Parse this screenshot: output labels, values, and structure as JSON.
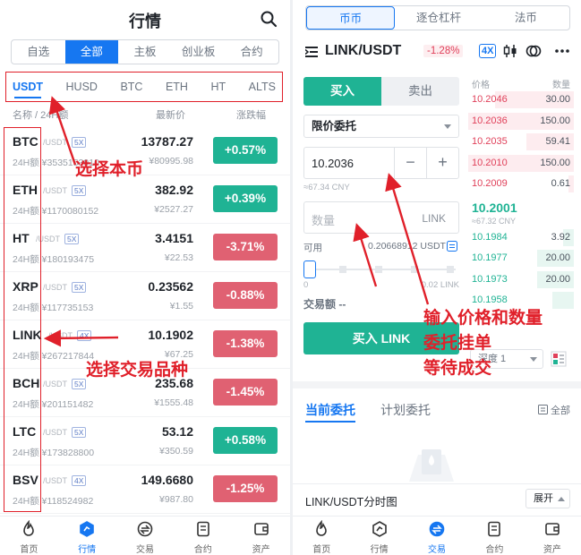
{
  "left": {
    "title": "行情",
    "segments": [
      "自选",
      "全部",
      "主板",
      "创业板",
      "合约"
    ],
    "active_segment": 1,
    "quote_tabs": [
      "USDT",
      "HUSD",
      "BTC",
      "ETH",
      "HT",
      "ALTS"
    ],
    "columns": {
      "name": "名称 / 24H额",
      "price": "最新价",
      "change": "涨跌幅"
    },
    "coins": [
      {
        "symbol": "BTC",
        "quote": "/USDT",
        "lev": "5X",
        "vol": "24H额 ¥3535153910",
        "price": "13787.27",
        "cny": "¥80995.98",
        "change": "+0.57%",
        "dir": "up"
      },
      {
        "symbol": "ETH",
        "quote": "/USDT",
        "lev": "5X",
        "vol": "24H额 ¥1170080152",
        "price": "382.92",
        "cny": "¥2527.27",
        "change": "+0.39%",
        "dir": "up"
      },
      {
        "symbol": "HT",
        "quote": "/USDT",
        "lev": "5X",
        "vol": "24H额 ¥180193475",
        "price": "3.4151",
        "cny": "¥22.53",
        "change": "-3.71%",
        "dir": "down"
      },
      {
        "symbol": "XRP",
        "quote": "/USDT",
        "lev": "5X",
        "vol": "24H额 ¥117735153",
        "price": "0.23562",
        "cny": "¥1.55",
        "change": "-0.88%",
        "dir": "down"
      },
      {
        "symbol": "LINK",
        "quote": "/USDT",
        "lev": "4X",
        "vol": "24H额 ¥267217844",
        "price": "10.1902",
        "cny": "¥67.25",
        "change": "-1.38%",
        "dir": "down"
      },
      {
        "symbol": "BCH",
        "quote": "/USDT",
        "lev": "5X",
        "vol": "24H额 ¥201151482",
        "price": "235.68",
        "cny": "¥1555.48",
        "change": "-1.45%",
        "dir": "down"
      },
      {
        "symbol": "LTC",
        "quote": "/USDT",
        "lev": "5X",
        "vol": "24H额 ¥173828800",
        "price": "53.12",
        "cny": "¥350.59",
        "change": "+0.58%",
        "dir": "up"
      },
      {
        "symbol": "BSV",
        "quote": "/USDT",
        "lev": "4X",
        "vol": "24H额 ¥118524982",
        "price": "149.6680",
        "cny": "¥987.80",
        "change": "-1.25%",
        "dir": "down"
      }
    ],
    "annotations": {
      "select_coin": "选择本币",
      "select_pair": "选择交易品种"
    }
  },
  "tabbar": [
    {
      "label": "首页",
      "icon": "home-flame-icon"
    },
    {
      "label": "行情",
      "icon": "market-icon"
    },
    {
      "label": "交易",
      "icon": "trade-icon"
    },
    {
      "label": "合约",
      "icon": "contract-icon"
    },
    {
      "label": "资产",
      "icon": "wallet-icon"
    }
  ],
  "left_tabbar_active": 1,
  "right_tabbar_active": 2,
  "right": {
    "segments": [
      "币币",
      "逐仓杠杆",
      "法币"
    ],
    "active_segment": 0,
    "pair": "LINK/USDT",
    "pair_change": "-1.28%",
    "leverage": "4X",
    "buy_label": "买入",
    "sell_label": "卖出",
    "order_type": "限价委托",
    "price": "10.2036",
    "price_cny": "≈67.34 CNY",
    "qty_placeholder": "数量",
    "qty_unit": "LINK",
    "available_label": "可用",
    "available_value": "0.20668912 USDT",
    "slider_min": "0",
    "slider_max": "0.02 LINK",
    "amount_label": "交易额 --",
    "buy_button": "买入 LINK",
    "ob_price_head": "价格",
    "ob_qty_head": "数量",
    "asks": [
      {
        "price": "10.2046",
        "qty": "30.00",
        "fill": 0.75
      },
      {
        "price": "10.2036",
        "qty": "150.00",
        "fill": 1.0
      },
      {
        "price": "10.2035",
        "qty": "59.41",
        "fill": 0.45
      },
      {
        "price": "10.2010",
        "qty": "150.00",
        "fill": 1.0
      },
      {
        "price": "10.2009",
        "qty": "0.61",
        "fill": 0.05
      }
    ],
    "last_price": "10.2001",
    "last_cny": "≈67.32 CNY",
    "bids": [
      {
        "price": "10.1984",
        "qty": "3.92",
        "fill": 0.1
      },
      {
        "price": "10.1977",
        "qty": "20.00",
        "fill": 0.35
      },
      {
        "price": "10.1973",
        "qty": "20.00",
        "fill": 0.35
      },
      {
        "price": "10.1958",
        "qty": "",
        "fill": 0.2
      }
    ],
    "depth_label": "深度 1",
    "tab_current": "当前委托",
    "tab_plan": "计划委托",
    "all_label": "全部",
    "timeline_label": "LINK/USDT分时图",
    "expand_label": "展开",
    "annotation": [
      "输入价格和数量",
      "委托挂单",
      "等待成交"
    ]
  },
  "colors": {
    "accent": "#1677f1",
    "up": "#1fb394",
    "down": "#e06172",
    "annotation": "#e0202a"
  }
}
